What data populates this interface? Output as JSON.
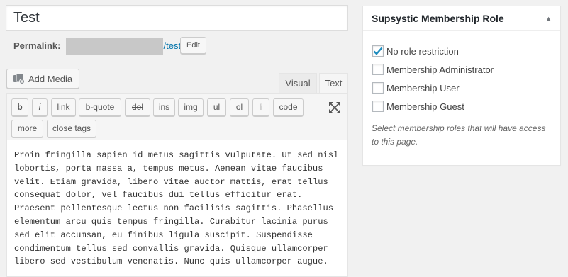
{
  "post": {
    "title": "Test",
    "permalink_label": "Permalink:",
    "permalink_slug": "/test/",
    "edit_label": "Edit"
  },
  "media": {
    "add_media_label": "Add Media",
    "icon": "media-icon"
  },
  "editor_tabs": {
    "visual": "Visual",
    "text": "Text"
  },
  "quicktags": {
    "b": "b",
    "i": "i",
    "link": "link",
    "bquote": "b-quote",
    "del": "del",
    "ins": "ins",
    "img": "img",
    "ul": "ul",
    "ol": "ol",
    "li": "li",
    "code": "code",
    "more": "more",
    "close_tags": "close tags"
  },
  "content": "Proin fringilla sapien id metus sagittis vulputate. Ut sed nisl\nlobortis, porta massa a, tempus metus. Aenean vitae faucibus\nvelit. Etiam gravida, libero vitae auctor mattis, erat tellus\nconsequat dolor, vel faucibus dui tellus efficitur erat.\nPraesent pellentesque lectus non facilisis sagittis. Phasellus\nelementum arcu quis tempus fringilla. Curabitur lacinia purus\nsed elit accumsan, eu finibus ligula suscipit. Suspendisse\ncondimentum tellus sed convallis gravida. Quisque ullamcorper\nlibero sed vestibulum venenatis. Nunc quis ullamcorper augue.",
  "membership_panel": {
    "title": "Supsystic Membership Role",
    "toggle_icon": "triangle-up-icon",
    "options": [
      {
        "label": "No role restriction",
        "checked": true
      },
      {
        "label": "Membership Administrator",
        "checked": false
      },
      {
        "label": "Membership User",
        "checked": false
      },
      {
        "label": "Membership Guest",
        "checked": false
      }
    ],
    "description": "Select membership roles that will have access to this page."
  },
  "colors": {
    "link": "#0073aa",
    "check": "#1e8cbe",
    "background": "#f1f1f1"
  }
}
